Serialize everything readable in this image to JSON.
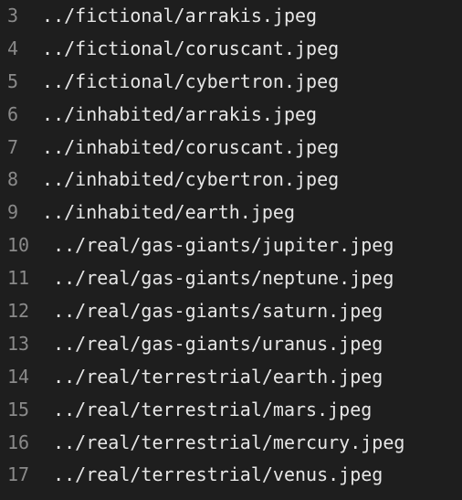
{
  "colors": {
    "background": "#1e1e1e",
    "line_number": "#8a8a8a",
    "text": "#e6e6e6"
  },
  "lines": [
    {
      "number": "3",
      "text": "../fictional/arrakis.jpeg"
    },
    {
      "number": "4",
      "text": "../fictional/coruscant.jpeg"
    },
    {
      "number": "5",
      "text": "../fictional/cybertron.jpeg"
    },
    {
      "number": "6",
      "text": "../inhabited/arrakis.jpeg"
    },
    {
      "number": "7",
      "text": "../inhabited/coruscant.jpeg"
    },
    {
      "number": "8",
      "text": "../inhabited/cybertron.jpeg"
    },
    {
      "number": "9",
      "text": "../inhabited/earth.jpeg"
    },
    {
      "number": "10",
      "text": "../real/gas-giants/jupiter.jpeg"
    },
    {
      "number": "11",
      "text": "../real/gas-giants/neptune.jpeg"
    },
    {
      "number": "12",
      "text": "../real/gas-giants/saturn.jpeg"
    },
    {
      "number": "13",
      "text": "../real/gas-giants/uranus.jpeg"
    },
    {
      "number": "14",
      "text": "../real/terrestrial/earth.jpeg"
    },
    {
      "number": "15",
      "text": "../real/terrestrial/mars.jpeg"
    },
    {
      "number": "16",
      "text": "../real/terrestrial/mercury.jpeg"
    },
    {
      "number": "17",
      "text": "../real/terrestrial/venus.jpeg"
    }
  ]
}
